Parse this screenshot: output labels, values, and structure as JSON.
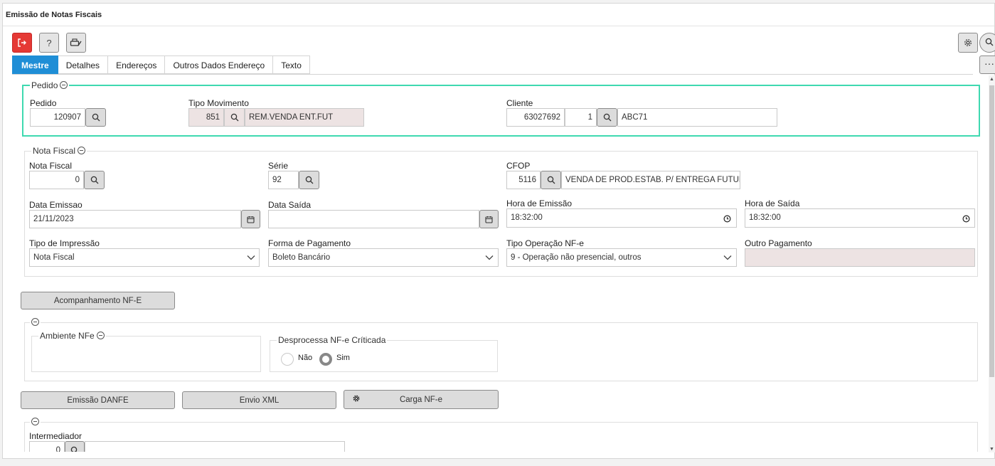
{
  "window": {
    "title": "Emissão de Notas Fiscais"
  },
  "toolbar": {
    "exit": "exit-icon",
    "help": "?",
    "print": "print-icon",
    "settings": "gear-icon",
    "search": "search-icon",
    "more": "···"
  },
  "tabs": [
    {
      "label": "Mestre",
      "active": true
    },
    {
      "label": "Detalhes"
    },
    {
      "label": "Endereços"
    },
    {
      "label": "Outros Dados Endereço"
    },
    {
      "label": "Texto"
    }
  ],
  "pedido": {
    "legend": "Pedido",
    "pedido_label": "Pedido",
    "pedido_value": "120907",
    "tipo_mov_label": "Tipo Movimento",
    "tipo_mov_code": "851",
    "tipo_mov_desc": "REM.VENDA ENT.FUT",
    "cliente_label": "Cliente",
    "cliente_code": "63027692",
    "cliente_seq": "1",
    "cliente_name": "ABC71"
  },
  "nota_fiscal": {
    "legend": "Nota Fiscal",
    "nf_label": "Nota Fiscal",
    "nf_value": "0",
    "serie_label": "Série",
    "serie_value": "92",
    "cfop_label": "CFOP",
    "cfop_code": "5116",
    "cfop_desc": "VENDA DE PROD.ESTAB. P/ ENTREGA FUTURA",
    "data_emissao_label": "Data Emissao",
    "data_emissao_value": "21/11/2023",
    "data_saida_label": "Data Saída",
    "data_saida_value": "",
    "hora_emissao_label": "Hora de Emissão",
    "hora_emissao_value": "18:32:00",
    "hora_saida_label": "Hora de Saída",
    "hora_saida_value": "18:32:00",
    "tipo_impressao_label": "Tipo de Impressão",
    "tipo_impressao_value": "Nota Fiscal",
    "forma_pagamento_label": "Forma de Pagamento",
    "forma_pagamento_value": "Boleto Bancário",
    "tipo_operacao_label": "Tipo Operação NF-e",
    "tipo_operacao_value": "9 - Operação não presencial, outros",
    "outro_pagamento_label": "Outro Pagamento",
    "outro_pagamento_value": ""
  },
  "acompanhamento_button": "Acompanhamento NF-E",
  "ambiente": {
    "legend": "Ambiente NFe",
    "desprocessa_legend": "Desprocessa NF-e Críticada",
    "option_nao": "Não",
    "option_sim": "Sim",
    "selected": "Sim"
  },
  "actions": {
    "emissao_danfe": "Emissão DANFE",
    "envio_xml": "Envio XML",
    "carga_nfe": "Carga NF-e"
  },
  "intermediador": {
    "label": "Intermediador",
    "code": "0",
    "name": ""
  },
  "colors": {
    "accent": "#1f8ed6",
    "exit_button": "#e53935",
    "highlight_border": "#3fd9b0"
  }
}
